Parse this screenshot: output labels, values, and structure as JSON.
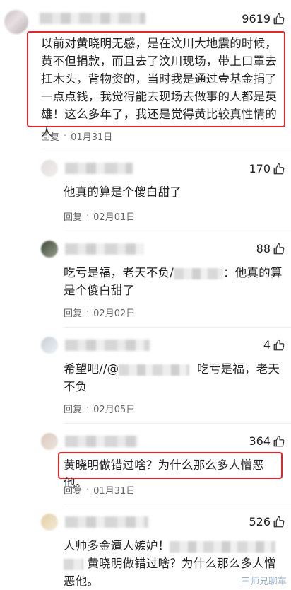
{
  "comments": [
    {
      "likes": "9619",
      "text": "以前对黄晓明无感，是在汶川大地震的时候，黄不但捐款，而且去了汶川现场，带上口罩去扛木头，背物资的，当时我是通过壹基金捐了一点点钱，我觉得能去现场去做事的人都是英雄！这么多年了，我还是觉得黄比较真性情的人",
      "reply": "回复",
      "date": "01月31日"
    },
    {
      "likes": "170",
      "text": "他真的算是个傻白甜了",
      "reply": "回复",
      "date": "02月01日"
    },
    {
      "likes": "88",
      "text_prefix": "吃亏是福，老天不负/",
      "text_suffix": "：他真的算是个傻白甜了",
      "reply": "回复",
      "date": "02月02日"
    },
    {
      "likes": "4",
      "text_prefix": "希望吧//@",
      "text_suffix": "吃亏是福，老天不负",
      "reply": "回复",
      "date": "02月05日"
    },
    {
      "likes": "364",
      "text": "黄晓明做错过啥？为什么那么多人憎恶他。",
      "reply": "回复",
      "date": "01月31日"
    },
    {
      "likes": "526",
      "text_prefix": "人帅多金遭人嫉妒！",
      "text_suffix": "黄晓明做错过啥？为什么那么多人憎恶他。"
    }
  ],
  "watermark": "三师兄聊车",
  "colors": {
    "highlight_border": "#e0262d",
    "meta_text": "#666666"
  },
  "icons": {
    "like": "thumbs-up-icon"
  }
}
